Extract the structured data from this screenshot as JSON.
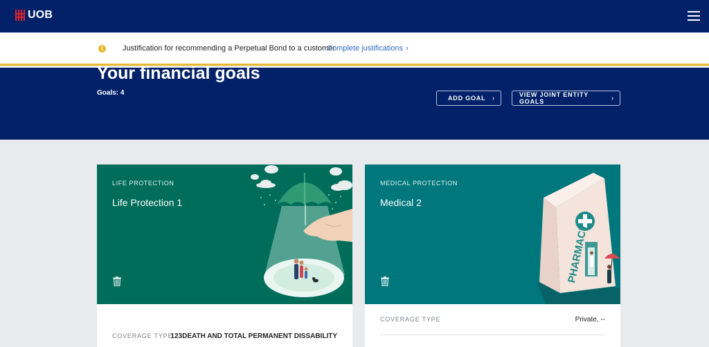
{
  "header": {
    "brand": "UOB",
    "brand_colors": {
      "navy": "#022169",
      "red": "#e4222b"
    },
    "menu_icon": "hamburger-icon"
  },
  "alert": {
    "icon": "warning-icon",
    "text": "Justification for recommending a Perpetual Bond to a customer",
    "link_label": "Complete justifications",
    "accent": "#e8b92d"
  },
  "hero": {
    "title": "Your financial goals",
    "goals_count": "Goals: 4",
    "add_goal_label": "ADD GOAL",
    "joint_goals_label": "VIEW JOINT ENTITY GOALS"
  },
  "cards": [
    {
      "category": "LIFE PROTECTION",
      "title": "Life Protection 1",
      "color": "#006d5b",
      "illustration": "umbrella-family-illustration",
      "coverage_label": "COVERAGE TYPE",
      "coverage_value": "123DEATH AND TOTAL PERMANENT DISSABILITY"
    },
    {
      "category": "MEDICAL PROTECTION",
      "title": "Medical 2",
      "color": "#00777c",
      "illustration": "pharmacy-bag-illustration",
      "illustration_text": "PHARMACY",
      "coverage_label": "COVERAGE TYPE",
      "coverage_value": "Private, --"
    }
  ]
}
